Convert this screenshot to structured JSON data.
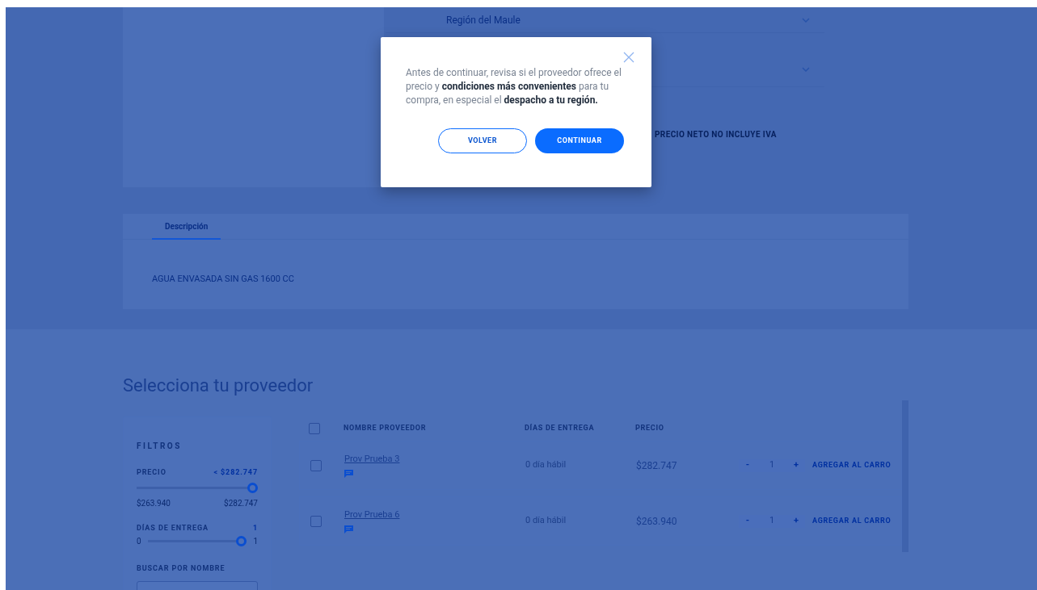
{
  "region_select": {
    "value": "Región del Maule"
  },
  "price_note": "PRECIO NETO NO INCLUYE IVA",
  "tabs": [
    {
      "label": "Descripción",
      "selected": true
    }
  ],
  "description": "AGUA ENVASADA SIN GAS 1600 CC",
  "section_title": "Selecciona tu proveedor",
  "filters": {
    "title": "FILTROS",
    "price": {
      "label": "PRECIO",
      "value": "< $282.747",
      "level": 1,
      "min": "$263.940",
      "max": "$282.747"
    },
    "delivery": {
      "label": "DÍAS DE ENTREGA",
      "value": "1",
      "level": 1,
      "min": "0",
      "max": "1"
    },
    "search_label": "BUSCAR POR NOMBRE"
  },
  "table": {
    "columns": [
      "NOMBRE PROVEEDOR",
      "DÍAS DE ENTREGA",
      "PRECIO"
    ],
    "select_all_checked": false,
    "rows": [
      {
        "name": "Prov Prueba 3",
        "delivery": "0 día hábil",
        "price": "$282.747",
        "minus": "-",
        "quantity": "1",
        "plus": "+",
        "action": "AGREGAR AL CARRO",
        "checked": false
      },
      {
        "name": "Prov Prueba 6",
        "delivery": "0 día hábil",
        "price": "$263.940",
        "minus": "-",
        "quantity": "1",
        "plus": "+",
        "action": "AGREGAR AL CARRO",
        "checked": false
      }
    ]
  },
  "modal": {
    "message": "Antes de continuar, revisa si el proveedor ofrece el precio y **condiciones más convenientes** para tu compra, en especial el **despacho a tu región.**",
    "buttons": [
      {
        "label": "VOLVER",
        "kind": "outline"
      },
      {
        "label": "CONTINUAR",
        "kind": "primary"
      }
    ]
  }
}
